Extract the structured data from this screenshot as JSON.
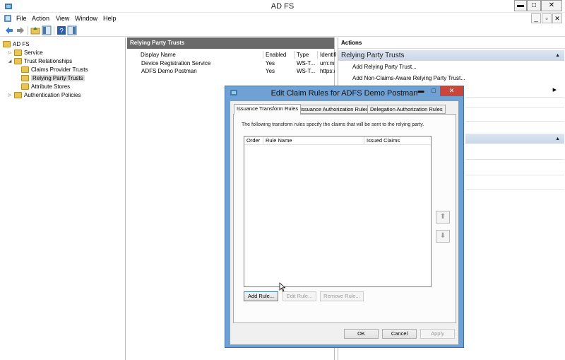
{
  "window": {
    "title": "AD FS"
  },
  "menu": {
    "items": [
      "File",
      "Action",
      "View",
      "Window",
      "Help"
    ]
  },
  "tree": {
    "root": "AD FS",
    "items": [
      {
        "label": "Service",
        "level": 1,
        "expander": "▷"
      },
      {
        "label": "Trust Relationships",
        "level": 1,
        "expander": "◢"
      },
      {
        "label": "Claims Provider Trusts",
        "level": 2,
        "expander": ""
      },
      {
        "label": "Relying Party Trusts",
        "level": 2,
        "expander": ""
      },
      {
        "label": "Attribute Stores",
        "level": 2,
        "expander": ""
      },
      {
        "label": "Authentication Policies",
        "level": 1,
        "expander": "▷"
      }
    ],
    "selected": "Relying Party Trusts"
  },
  "middle": {
    "header": "Relying Party Trusts",
    "columns": [
      "Display Name",
      "Enabled",
      "Type",
      "Identifi"
    ],
    "rows": [
      {
        "name": "Device Registration Service",
        "enabled": "Yes",
        "type": "WS-T...",
        "id": "urn:ms"
      },
      {
        "name": "ADFS Demo Postman",
        "enabled": "Yes",
        "type": "WS-T...",
        "id": "https:/"
      }
    ]
  },
  "actions": {
    "title": "Actions",
    "group": "Relying Party Trusts",
    "items": [
      "Add Relying Party Trust...",
      "Add Non-Claims-Aware Relying Party Trust..."
    ]
  },
  "dialog": {
    "title": "Edit Claim Rules for ADFS Demo Postman",
    "tabs": [
      "Issuance Transform Rules",
      "Issuance Authorization Rules",
      "Delegation Authorization Rules"
    ],
    "active_tab": "Issuance Transform Rules",
    "description": "The following transform rules specify the claims that will be sent to the relying party.",
    "columns": [
      "Order",
      "Rule Name",
      "Issued Claims"
    ],
    "buttons": {
      "add_rule": "Add Rule...",
      "edit_rule": "Edit Rule...",
      "remove_rule": "Remove Rule...",
      "ok": "OK",
      "cancel": "Cancel",
      "apply": "Apply"
    },
    "controls": {
      "min": "▬",
      "max": "□",
      "close": "✕"
    }
  },
  "window_controls": {
    "min": "▬",
    "max": "□",
    "close": "✕"
  },
  "mdi_controls": {
    "min": "_",
    "restore": "▫",
    "close": "✕"
  },
  "colors": {
    "dialog_frame": "#6fa1d4",
    "pane_header": "#6a6a6a",
    "close_red": "#c9473a"
  }
}
